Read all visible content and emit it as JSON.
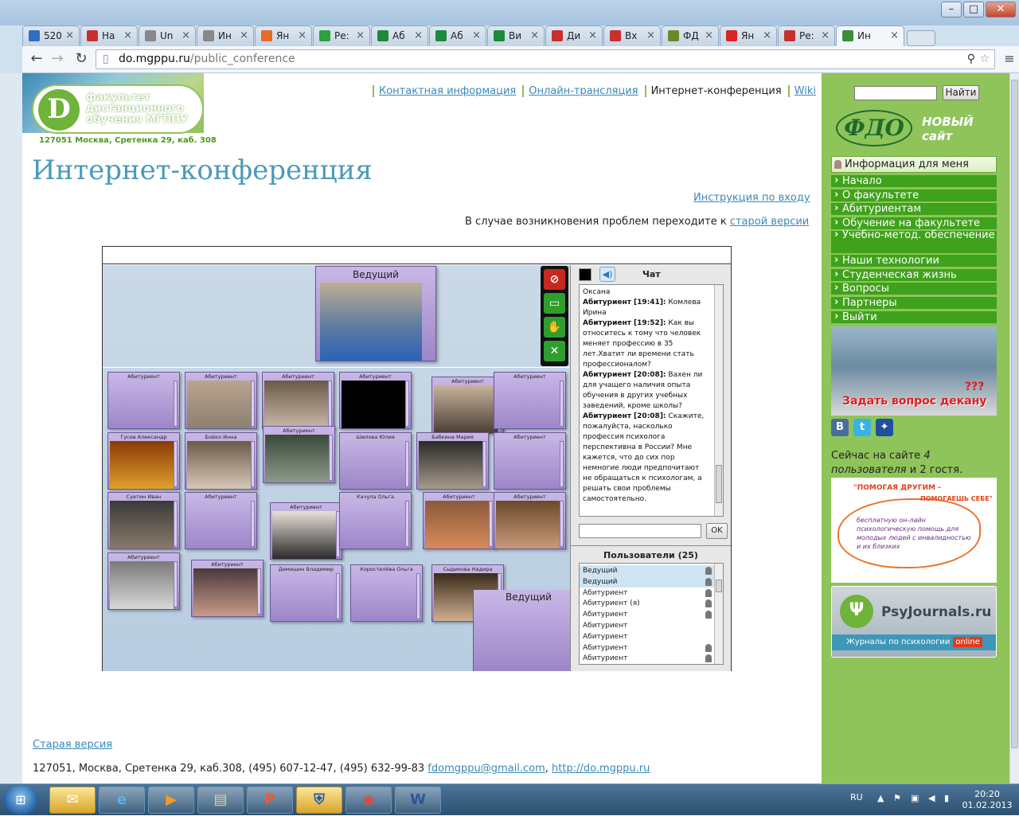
{
  "browser": {
    "tabs": [
      {
        "label": "520",
        "icon": "mail-icon",
        "color": "#2f6fc2"
      },
      {
        "label": "На",
        "icon": "gmail-icon",
        "color": "#c9302c"
      },
      {
        "label": "Un",
        "icon": "page-icon",
        "color": "#888888"
      },
      {
        "label": "Ин",
        "icon": "page-icon",
        "color": "#888888"
      },
      {
        "label": "Ян",
        "icon": "yandex-icon",
        "color": "#e86a24"
      },
      {
        "label": "Ре:",
        "icon": "drive-icon",
        "color": "#2f9f3f"
      },
      {
        "label": "Аб",
        "icon": "sheet-icon",
        "color": "#1f8a3a"
      },
      {
        "label": "Аб",
        "icon": "sheet-icon",
        "color": "#1f8a3a"
      },
      {
        "label": "Ви",
        "icon": "sheet-icon",
        "color": "#1f8a3a"
      },
      {
        "label": "Ди",
        "icon": "gmail-icon",
        "color": "#c9302c"
      },
      {
        "label": "Вх",
        "icon": "gmail-icon",
        "color": "#c9302c"
      },
      {
        "label": "ФД",
        "icon": "fdo-icon",
        "color": "#6a8a2a"
      },
      {
        "label": "Ян",
        "icon": "yandex-icon",
        "color": "#d22"
      },
      {
        "label": "Ре:",
        "icon": "gmail-icon",
        "color": "#c9302c"
      },
      {
        "label": "Ин",
        "icon": "chrome-icon",
        "color": "#3b8f3b"
      }
    ],
    "url_domain": "do.mgppu.ru",
    "url_path": "/public_conference"
  },
  "site": {
    "logo_text": "факультет дистанционного обучения МГППУ",
    "address": "127051 Москва, Сретенка 29, каб. 308",
    "nav": [
      "Контактная информация",
      "Онлайн-трансляция",
      "Интернет-конференция",
      "Wiki"
    ],
    "page_title": "Интернет-конференция",
    "login_link": "Инструкция по входу",
    "problems_text": "В случае возникновения проблем переходите к",
    "problems_link": "старой версии",
    "old_version": "Старая версия",
    "footer_text": "127051, Москва, Сретенка 29, каб.308, (495) 607-12-47, (495) 632-99-83",
    "footer_email": "fdomgppu@gmail.com",
    "footer_url": "http://do.mgppu.ru"
  },
  "conference": {
    "leader_label": "Ведущий",
    "leader2_label": "Ведущий",
    "tiles": [
      "Абитуриент",
      "Абитуриент",
      "Абитуриент",
      "Абитуриент",
      "Абитуриент",
      "Абитуриент",
      "Гусев Александр",
      "Бойко Инна",
      "Абитуриент",
      "Шилова Юлия",
      "Бабкина Мария",
      "Абитуриент",
      "Суетин Иван",
      "Абитуриент",
      "Абитуриент",
      "Качула Ольга",
      "Абитуриент",
      "Абитуриент",
      "Абитуриент",
      "Абитуриент",
      "Демишин Владимир",
      "Коростелёва Ольга",
      "Сыдикова Надира"
    ],
    "chat_title": "Чат",
    "chat_messages": [
      {
        "author": "",
        "text": "Оксана"
      },
      {
        "author": "Абитуриент [19:41]:",
        "text": " Комлева Ирина"
      },
      {
        "author": "Абитуриент [19:52]:",
        "text": " Как вы относитесь к тому что человек меняет профессию в 35 лет.Хватит ли времени стать профессионалом?"
      },
      {
        "author": "Абитуриент [20:08]:",
        "text": " Вахен ли для учащего наличия опыта обучения в других учебных заведений, кроме школы?"
      },
      {
        "author": "Абитуриент [20:08]:",
        "text": " Скажите, пожалуйста, насколько профессия психолога перспективна в России? Мне кажется, что до сих пор немногие люди предпочитают не обращаться к психологам, а решать свои проблемы самостоятельно."
      }
    ],
    "ok_label": "OK",
    "users_title": "Пользователи (25)",
    "users": [
      "Ведущий",
      "Ведущий",
      "Абитуриент",
      "Абитуриент (я)",
      "Абитуриент",
      "Абитуриент",
      "Абитуриент",
      "Абитуриент",
      "Абитуриент"
    ]
  },
  "sidebar": {
    "search_button": "Найти",
    "fdo_logo": "ФДО",
    "new_site": "НОВЫЙ сайт",
    "info_for_me": "Информация для меня",
    "menu": [
      "Начало",
      "О факультете",
      "Абитуриентам",
      "Обучение на факультете",
      "Учебно-метод. обеспечение",
      "Наши технологии",
      "Студенческая жизнь",
      "Вопросы",
      "Партнеры",
      "Выйти"
    ],
    "ask_dean": "Задать вопрос декану",
    "ask_marks": "???",
    "online_prefix": "Сейчас на сайте",
    "online_users": "4 пользователя",
    "online_suffix": "и 2 гостя.",
    "banner1_title": "\"ПОМОГАЯ ДРУГИМ -",
    "banner1_sub": "ПОМОГАЕШЬ СЕБЕ\"",
    "banner1_text": "бесплатную он-лайн психологическую помощь для молодых людей с инвалидностью и их близких",
    "psy_name": "PsyJournals.ru",
    "psy_sub": "Журналы по психологии",
    "psy_online": "online"
  },
  "taskbar": {
    "lang": "RU",
    "time": "20:20",
    "date": "01.02.2013"
  }
}
